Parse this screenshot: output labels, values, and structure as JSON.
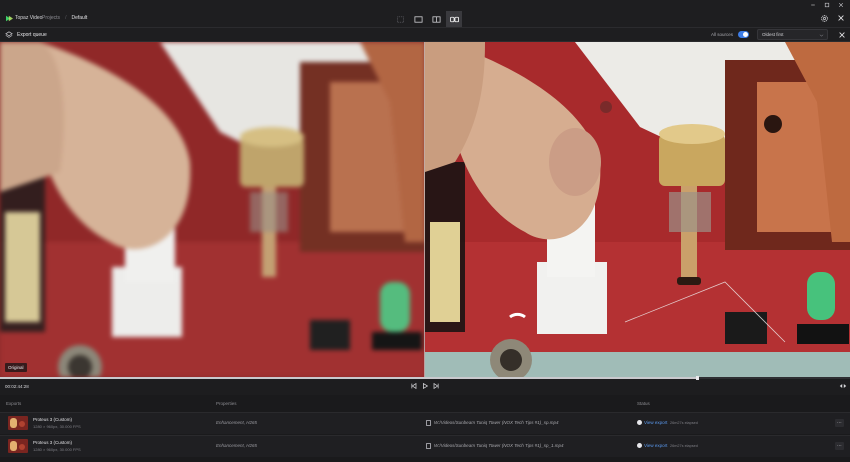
{
  "app": {
    "title": "Topaz Video"
  },
  "breadcrumb": {
    "items": [
      "Projects",
      "Default"
    ]
  },
  "view_modes": [
    "single-view-icon",
    "original-view-icon",
    "side-by-side-icon",
    "split-compare-icon"
  ],
  "toolbar": {
    "export_queue_label": "Export queue",
    "sources_label": "All sources",
    "sources_toggle_on": true,
    "sort_value": "Oldest first"
  },
  "preview": {
    "left_badge": "Original"
  },
  "timeline": {
    "timecode": "00:02:44:28",
    "progress": 0.82
  },
  "exports": {
    "headers": {
      "exports": "Exports",
      "properties": "Properties",
      "status": "Status"
    },
    "rows": [
      {
        "model": "Proteus 3 (Custom)",
        "spec": "1280 × 960px, 30.000 FPS",
        "properties": "Enhancement, H265",
        "path": "W:/Videos/Sunbeam Tuniq Tower (NOX Tech Tips #1)_sp.mp4",
        "status": "View export",
        "elapsed": "26m27s elapsed"
      },
      {
        "model": "Proteus 3 (Custom)",
        "spec": "1280 × 960px, 30.000 FPS",
        "properties": "Enhancement, H265",
        "path": "W:/Videos/Sunbeam Tuniq Tower (NOX Tech Tips #1)_sp_1.mp4",
        "status": "View export",
        "elapsed": "26m27s elapsed"
      }
    ]
  },
  "colors": {
    "accent": "#3d7de6",
    "link": "#5b9af0",
    "bg": "#1b1b1d",
    "pcb": "#9a2828"
  }
}
